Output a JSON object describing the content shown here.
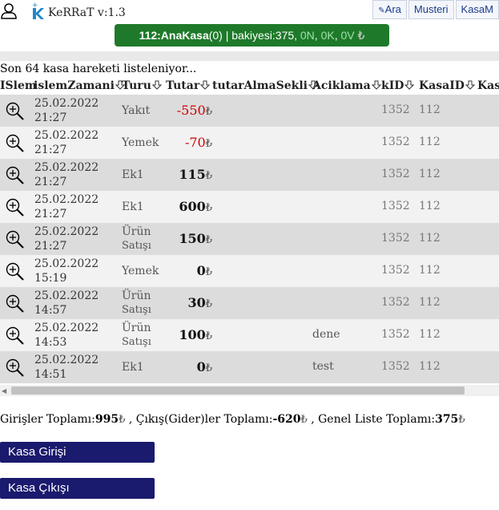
{
  "app": {
    "title": "KeRRaT v:1.3"
  },
  "nav": {
    "search_label": "Ara",
    "customer_label": "Musteri",
    "kasa_label": "KasaM"
  },
  "banner": {
    "kasa_name": "112:AnaKasa",
    "count": "(0)",
    "balance_text": " | bakiyesi:375, ",
    "n_val": "0N",
    "k_val": "0K",
    "v_val": "0V",
    "sep": ", ",
    "currency": "₺"
  },
  "list_info": "Son 64 kasa hareketi listeleniyor...",
  "columns": [
    "ISlem",
    "islemZamani",
    "Turu",
    "Tutar",
    "tutarAlmaSekli",
    "Aciklama",
    "kID",
    "KasaID",
    "Kas"
  ],
  "currency_symbol": "₺",
  "rows": [
    {
      "date": "25.02.2022",
      "time": "21:27",
      "type": "Yakıt",
      "type2": "",
      "amount": "-550",
      "negative": true,
      "desc": "",
      "kid": "1352",
      "kasaid": "112"
    },
    {
      "date": "25.02.2022",
      "time": "21:27",
      "type": "Yemek",
      "type2": "",
      "amount": "-70",
      "negative": true,
      "desc": "",
      "kid": "1352",
      "kasaid": "112"
    },
    {
      "date": "25.02.2022",
      "time": "21:27",
      "type": "Ek1",
      "type2": "",
      "amount": "115",
      "negative": false,
      "desc": "",
      "kid": "1352",
      "kasaid": "112"
    },
    {
      "date": "25.02.2022",
      "time": "21:27",
      "type": "Ek1",
      "type2": "",
      "amount": "600",
      "negative": false,
      "desc": "",
      "kid": "1352",
      "kasaid": "112"
    },
    {
      "date": "25.02.2022",
      "time": "21:27",
      "type": "Ürün",
      "type2": "Satışı",
      "amount": "150",
      "negative": false,
      "desc": "",
      "kid": "1352",
      "kasaid": "112"
    },
    {
      "date": "25.02.2022",
      "time": "15:19",
      "type": "Yemek",
      "type2": "",
      "amount": "0",
      "negative": false,
      "desc": "",
      "kid": "1352",
      "kasaid": "112"
    },
    {
      "date": "25.02.2022",
      "time": "14:57",
      "type": "Ürün",
      "type2": "Satışı",
      "amount": "30",
      "negative": false,
      "desc": "",
      "kid": "1352",
      "kasaid": "112"
    },
    {
      "date": "25.02.2022",
      "time": "14:53",
      "type": "Ürün",
      "type2": "Satışı",
      "amount": "100",
      "negative": false,
      "desc": "dene",
      "kid": "1352",
      "kasaid": "112"
    },
    {
      "date": "25.02.2022",
      "time": "14:51",
      "type": "Ek1",
      "type2": "",
      "amount": "0",
      "negative": false,
      "desc": "test",
      "kid": "1352",
      "kasaid": "112"
    }
  ],
  "totals": {
    "in_label": "Girişler Toplamı:",
    "in_value": "995",
    "out_label": " , Çıkış(Gider)ler Toplamı:",
    "out_value": "-620",
    "gen_label": " , Genel Liste Toplamı:",
    "gen_value": "375"
  },
  "buttons": {
    "kasa_in": "Kasa Girişi",
    "kasa_out": "Kasa Çıkışı"
  },
  "colors": {
    "banner_bg": "#1e7a2a",
    "button_bg": "#1a1a6e",
    "negative": "#d10000"
  }
}
